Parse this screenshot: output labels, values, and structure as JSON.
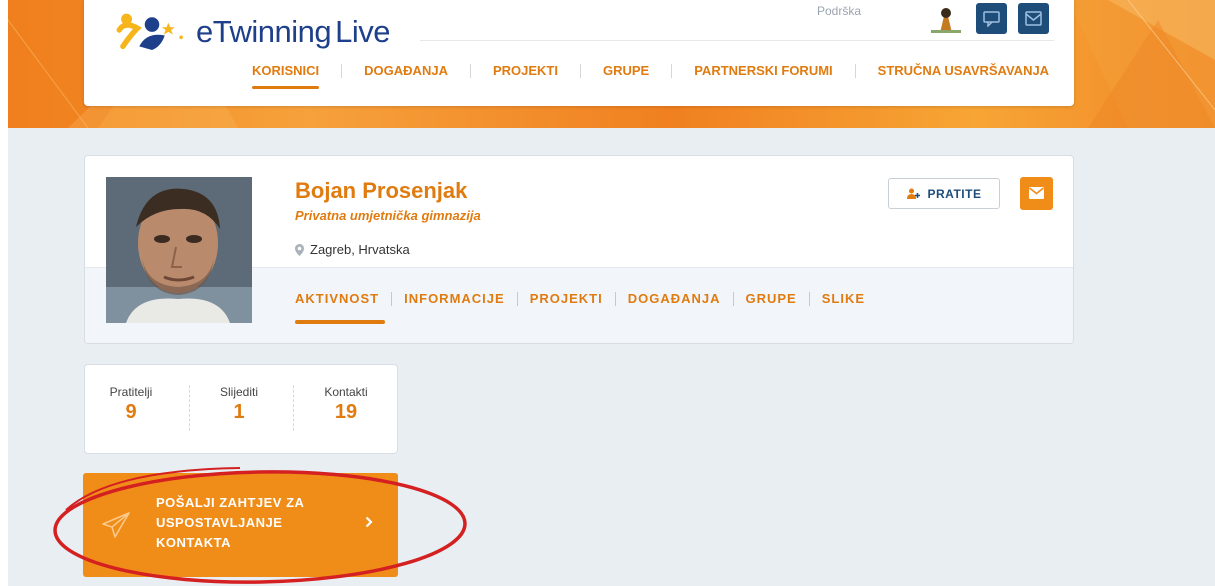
{
  "header": {
    "logo_text_e": "e",
    "logo_text_twinning": "Twinning",
    "logo_text_live": "Live",
    "help_text": "Podrška",
    "nav": [
      {
        "label": "KORISNICI",
        "active": true
      },
      {
        "label": "DOGAĐANJA",
        "active": false
      },
      {
        "label": "PROJEKTI",
        "active": false
      },
      {
        "label": "GRUPE",
        "active": false
      },
      {
        "label": "PARTNERSKI FORUMI",
        "active": false
      },
      {
        "label": "STRUČNA USAVRŠAVANJA",
        "active": false
      }
    ]
  },
  "profile": {
    "name": "Bojan Prosenjak",
    "school": "Privatna umjetnička gimnazija",
    "location": "Zagreb, Hrvatska",
    "follow_label": "PRATITE",
    "tabs": [
      {
        "label": "AKTIVNOST",
        "active": true
      },
      {
        "label": "INFORMACIJE",
        "active": false
      },
      {
        "label": "PROJEKTI",
        "active": false
      },
      {
        "label": "DOGAĐANJA",
        "active": false
      },
      {
        "label": "GRUPE",
        "active": false
      },
      {
        "label": "SLIKE",
        "active": false
      }
    ]
  },
  "stats": [
    {
      "label": "Pratitelji",
      "value": "9"
    },
    {
      "label": "Slijediti",
      "value": "1"
    },
    {
      "label": "Kontakti",
      "value": "19"
    }
  ],
  "contact_request": {
    "line1": "POŠALJI ZAHTJEV ZA",
    "line2": "USPOSTAVLJANJE",
    "line3": "KONTAKTA"
  },
  "colors": {
    "accent": "#e07b10",
    "button_orange": "#f08c18",
    "nav_blue": "#1e4d7a",
    "highlight_ellipse": "#d42020"
  }
}
